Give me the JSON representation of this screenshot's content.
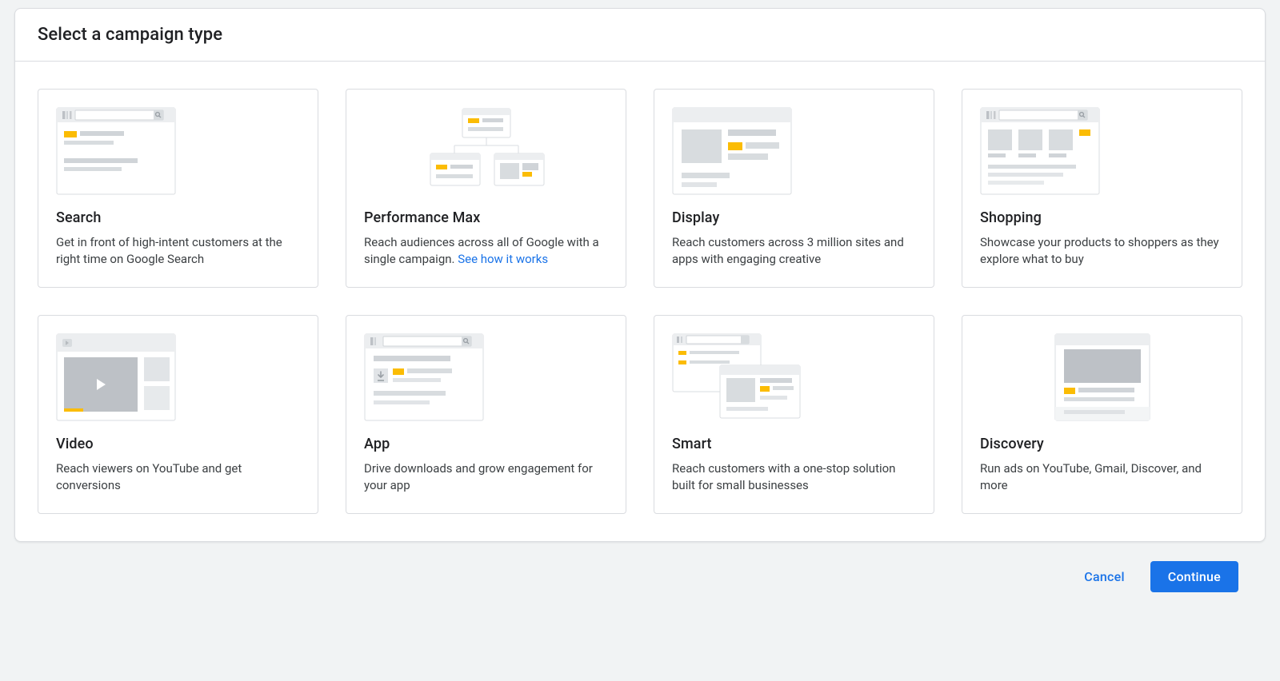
{
  "header": {
    "title": "Select a campaign type"
  },
  "cards": [
    {
      "id": "search",
      "title": "Search",
      "desc": "Get in front of high-intent customers at the right time on Google Search",
      "link": null
    },
    {
      "id": "performance-max",
      "title": "Performance Max",
      "desc": "Reach audiences across all of Google with a single campaign. ",
      "link": "See how it works"
    },
    {
      "id": "display",
      "title": "Display",
      "desc": "Reach customers across 3 million sites and apps with engaging creative",
      "link": null
    },
    {
      "id": "shopping",
      "title": "Shopping",
      "desc": "Showcase your products to shoppers as they explore what to buy",
      "link": null
    },
    {
      "id": "video",
      "title": "Video",
      "desc": "Reach viewers on YouTube and get conversions",
      "link": null
    },
    {
      "id": "app",
      "title": "App",
      "desc": "Drive downloads and grow engagement for your app",
      "link": null
    },
    {
      "id": "smart",
      "title": "Smart",
      "desc": "Reach customers with a one-stop solution built for small businesses",
      "link": null
    },
    {
      "id": "discovery",
      "title": "Discovery",
      "desc": "Run ads on YouTube, Gmail, Discover, and more",
      "link": null
    }
  ],
  "footer": {
    "cancel": "Cancel",
    "continue": "Continue"
  },
  "colors": {
    "accent": "#fbbc04",
    "primary": "#1a73e8"
  }
}
